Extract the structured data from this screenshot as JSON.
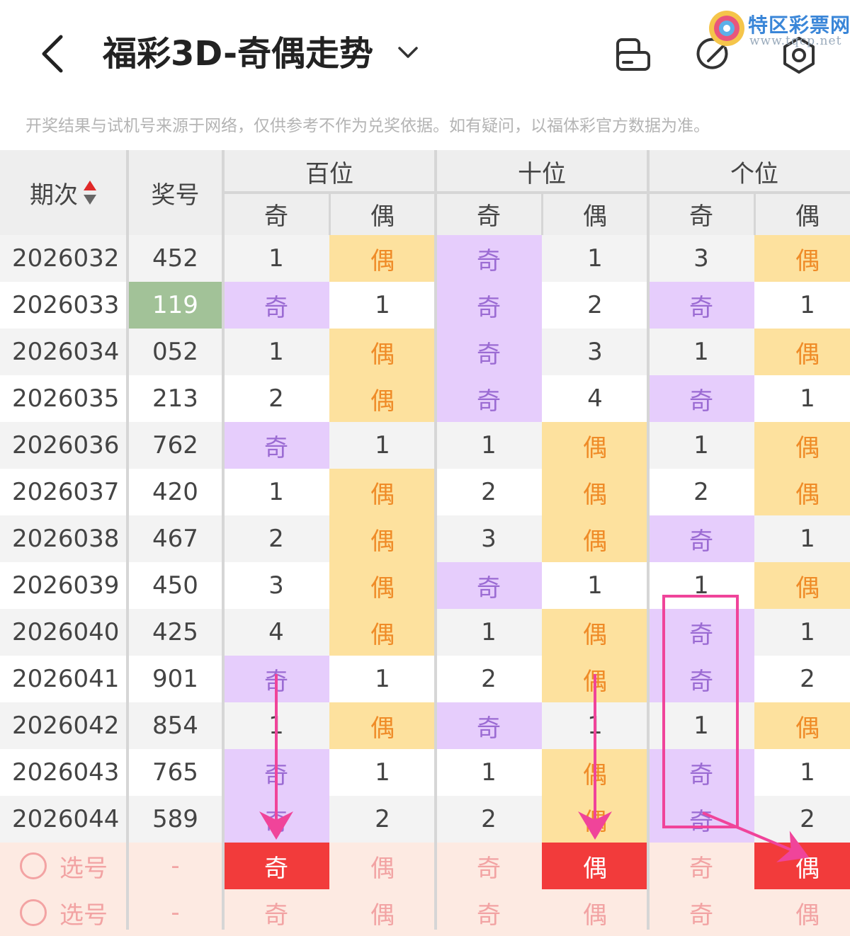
{
  "header": {
    "title": "福彩3D-奇偶走势",
    "back_icon": "chevron-left-icon",
    "dropdown_icon": "chevron-down-icon",
    "tools": [
      "phone-rotate-icon",
      "pen-icon",
      "settings-icon"
    ]
  },
  "brand": {
    "name": "特区彩票网",
    "url": "www.tqcp.net"
  },
  "notice": "开奖结果与试机号来源于网络，仅供参考不作为兑奖依据。如有疑问，以福体彩官方数据为准。",
  "table": {
    "col_issue": "期次",
    "col_number": "奖号",
    "sort_icon": "sort-updown-icon",
    "groups": [
      "百位",
      "十位",
      "个位"
    ],
    "sub_odd": "奇",
    "sub_even": "偶",
    "rows": [
      {
        "issue": "2026032",
        "number": "452",
        "cells": [
          "1",
          "偶",
          "奇",
          "1",
          "3",
          "偶"
        ]
      },
      {
        "issue": "2026033",
        "number": "119",
        "highlight": true,
        "cells": [
          "奇",
          "1",
          "奇",
          "2",
          "奇",
          "1"
        ]
      },
      {
        "issue": "2026034",
        "number": "052",
        "cells": [
          "1",
          "偶",
          "奇",
          "3",
          "1",
          "偶"
        ]
      },
      {
        "issue": "2026035",
        "number": "213",
        "cells": [
          "2",
          "偶",
          "奇",
          "4",
          "奇",
          "1"
        ]
      },
      {
        "issue": "2026036",
        "number": "762",
        "cells": [
          "奇",
          "1",
          "1",
          "偶",
          "1",
          "偶"
        ]
      },
      {
        "issue": "2026037",
        "number": "420",
        "cells": [
          "1",
          "偶",
          "2",
          "偶",
          "2",
          "偶"
        ]
      },
      {
        "issue": "2026038",
        "number": "467",
        "cells": [
          "2",
          "偶",
          "3",
          "偶",
          "奇",
          "1"
        ]
      },
      {
        "issue": "2026039",
        "number": "450",
        "cells": [
          "3",
          "偶",
          "奇",
          "1",
          "1",
          "偶"
        ]
      },
      {
        "issue": "2026040",
        "number": "425",
        "cells": [
          "4",
          "偶",
          "1",
          "偶",
          "奇",
          "1"
        ]
      },
      {
        "issue": "2026041",
        "number": "901",
        "cells": [
          "奇",
          "1",
          "2",
          "偶",
          "奇",
          "2"
        ]
      },
      {
        "issue": "2026042",
        "number": "854",
        "cells": [
          "1",
          "偶",
          "奇",
          "1",
          "1",
          "偶"
        ]
      },
      {
        "issue": "2026043",
        "number": "765",
        "cells": [
          "奇",
          "1",
          "1",
          "偶",
          "奇",
          "1"
        ]
      },
      {
        "issue": "2026044",
        "number": "589",
        "cells": [
          "奇",
          "2",
          "2",
          "偶",
          "奇",
          "2"
        ]
      }
    ],
    "pick_rows": [
      {
        "label": "选号",
        "number": "-",
        "cells": [
          "奇",
          "偶",
          "奇",
          "偶",
          "奇",
          "偶"
        ],
        "selected": [
          0,
          3,
          5
        ]
      },
      {
        "label": "选号",
        "number": "-",
        "cells": [
          "奇",
          "偶",
          "奇",
          "偶",
          "奇",
          "偶"
        ],
        "selected": []
      }
    ]
  },
  "colors": {
    "odd_bg": "#e6cdfc",
    "odd_text": "#9b6bd3",
    "even_bg": "#fde19e",
    "even_text": "#ef8b27",
    "highlight_bg": "#a2c298",
    "pick_bg": "#fdeae2",
    "pick_selected": "#f23b3b",
    "annotation": "#f0449a"
  }
}
